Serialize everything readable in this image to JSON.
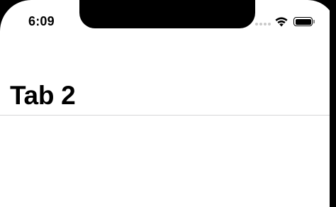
{
  "status_bar": {
    "time": "6:09",
    "signal_icon": "cellular-signal-icon",
    "wifi_icon": "wifi-icon",
    "battery_icon": "battery-icon",
    "battery_level": 1.0
  },
  "navigation": {
    "title": "Tab 2"
  },
  "colors": {
    "background": "#ffffff",
    "text": "#000000",
    "separator": "#d6d6d8",
    "bezel": "#000000"
  }
}
